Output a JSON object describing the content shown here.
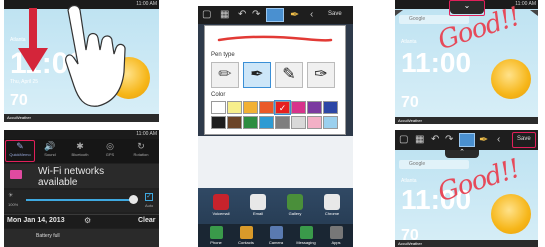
{
  "status_time": "11:00 AM",
  "panel1": {
    "weather_city": "Atlanta",
    "weather_time": "11:00",
    "weather_date": "Thu, April 25",
    "temperature": "70",
    "brand": "AccuWeather"
  },
  "panel2": {
    "quick_settings": [
      "QuickMemo",
      "Sound",
      "Bluetooth",
      "GPS",
      "Rotation"
    ],
    "wifi_title": "Wi-Fi networks",
    "wifi_sub": "available",
    "brightness_label": "100%",
    "auto_label": "Auto",
    "date": "Mon Jan 14, 2013",
    "clear_label": "Clear",
    "battery_label": "Battery full"
  },
  "panel3": {
    "save_label": "Save",
    "pen_type_label": "Pen type",
    "color_label": "Color",
    "apps": [
      "Voicemail",
      "Email",
      "Gallery",
      "Chrome"
    ],
    "dock": [
      "Phone",
      "Contacts",
      "Camera",
      "Messaging",
      "Apps"
    ],
    "colors": [
      "#ffffff",
      "#f7ef8c",
      "#f2b134",
      "#ea5a28",
      "#e7201f",
      "#d7338b",
      "#7b3aa0",
      "#2c46a5",
      "#1d1d1d",
      "#6b4427",
      "#2f8d41",
      "#2d9bd3",
      "#7f7f7f",
      "#d9d9d9",
      "#f3b0c6",
      "#9bd0ee"
    ]
  },
  "panel4": {
    "search_label": "Google",
    "weather_city": "Atlanta",
    "weather_time": "11:00",
    "temperature": "70",
    "brand": "AccuWeather",
    "handwritten": "Good!!"
  },
  "panel5": {
    "save_label": "Save",
    "search_label": "Google",
    "weather_city": "Atlanta",
    "weather_time": "11:00",
    "temperature": "70",
    "brand": "AccuWeather",
    "handwritten": "Good!!"
  }
}
